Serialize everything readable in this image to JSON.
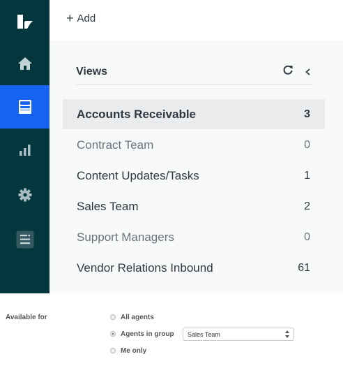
{
  "topbar": {
    "add_label": "Add"
  },
  "sidebar": {
    "items": [
      {
        "icon": "logo-icon"
      },
      {
        "icon": "home-icon"
      },
      {
        "icon": "views-icon",
        "active": true
      },
      {
        "icon": "reports-icon"
      },
      {
        "icon": "settings-icon"
      },
      {
        "icon": "apps-icon"
      }
    ]
  },
  "views": {
    "title": "Views",
    "items": [
      {
        "label": "Accounts Receivable",
        "count": "3"
      },
      {
        "label": "Contract Team",
        "count": "0"
      },
      {
        "label": "Content Updates/Tasks",
        "count": "1"
      },
      {
        "label": "Sales Team",
        "count": "2"
      },
      {
        "label": "Support Managers",
        "count": "0"
      },
      {
        "label": "Vendor Relations Inbound",
        "count": "61"
      }
    ]
  },
  "availability": {
    "label": "Available for",
    "options": [
      "All agents",
      "Agents in group",
      "Me only"
    ],
    "selected_option": "Agents in group",
    "group_select_value": "Sales Team"
  },
  "colors": {
    "sidebar": "#03363d",
    "sidebar_active": "#1663f2",
    "panel": "#f8f9f9",
    "selected_row": "#e9ebed"
  }
}
